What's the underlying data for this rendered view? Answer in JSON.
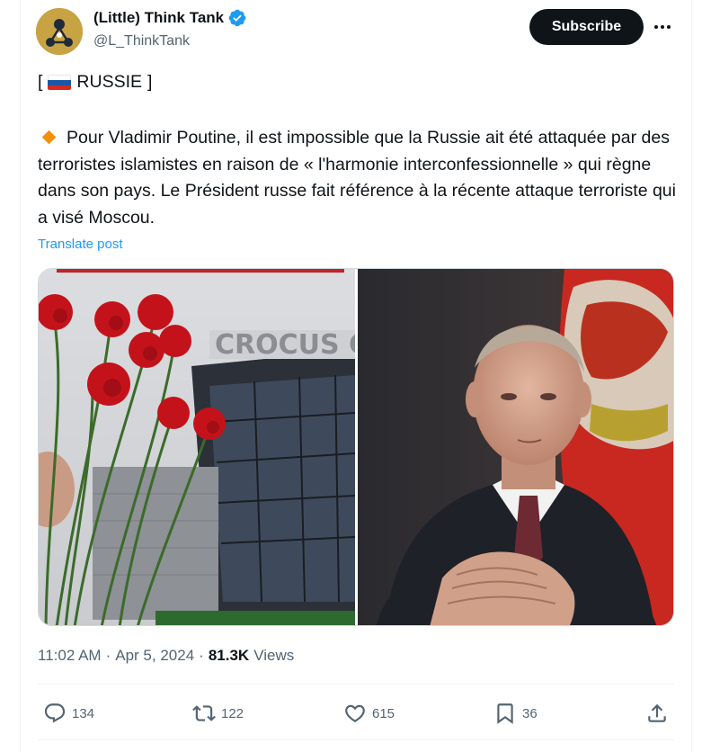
{
  "author": {
    "display_name": "(Little) Think Tank",
    "handle": "@L_ThinkTank",
    "verified": true,
    "avatar": "think-tank-logo"
  },
  "header": {
    "subscribe_label": "Subscribe",
    "more_icon": "ellipsis-icon"
  },
  "post": {
    "tag_open": "[",
    "tag_label": "RUSSIE",
    "tag_close": "]",
    "flag_icon": "russia-flag-icon",
    "bullet_icon": "orange-diamond-icon",
    "text": "Pour Vladimir Poutine, il est impossible que la Russie ait été attaquée par des terroristes islamistes en raison de « l'harmonie interconfessionnelle » qui règne dans son pays. Le Président russe fait référence à la récente attaque terroriste qui a visé Moscou.",
    "translate_label": "Translate post"
  },
  "media": {
    "left_sign_text": "CROCUS CI",
    "left_image": "red carnations in front of the burned Crocus City Hall",
    "right_image": "Vladimir Putin seated with clasped hands, Russian flag behind"
  },
  "meta": {
    "time": "11:02 AM",
    "date": "Apr 5, 2024",
    "separator": "·",
    "views_count": "81.3K",
    "views_label": "Views"
  },
  "actions": {
    "replies": "134",
    "reposts": "122",
    "likes": "615",
    "bookmarks": "36"
  },
  "colors": {
    "accent": "#1d9bf0",
    "text_primary": "#0f1419",
    "text_secondary": "#536471",
    "diamond": "#f4900c"
  }
}
